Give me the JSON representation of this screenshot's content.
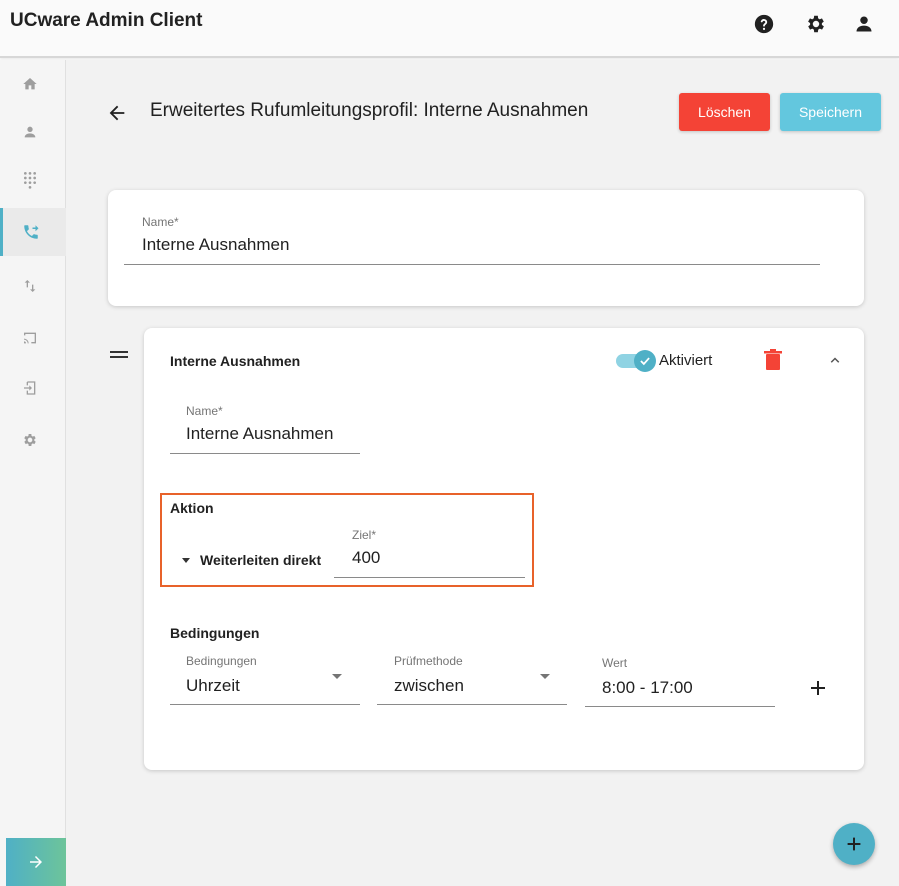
{
  "app": {
    "title": "UCware Admin Client"
  },
  "topbar": {
    "icons": [
      "help-icon",
      "settings-icon",
      "user-icon"
    ]
  },
  "sidebar": {
    "items": [
      {
        "icon": "home-icon"
      },
      {
        "icon": "person-icon"
      },
      {
        "icon": "dialpad-icon"
      },
      {
        "icon": "phone-forward-icon",
        "active": true
      },
      {
        "icon": "swap-vert-icon"
      },
      {
        "icon": "cast-icon"
      },
      {
        "icon": "device-login-icon"
      },
      {
        "icon": "gear-icon"
      }
    ]
  },
  "header": {
    "title": "Erweitertes Rufumleitungsprofil: Interne Ausnahmen",
    "delete_label": "Löschen",
    "save_label": "Speichern"
  },
  "profile": {
    "name_label": "Name*",
    "name_value": "Interne Ausnahmen"
  },
  "rule": {
    "title": "Interne Ausnahmen",
    "toggle_label": "Aktiviert",
    "toggle_on": true,
    "name_label": "Name*",
    "name_value": "Interne Ausnahmen",
    "action": {
      "heading": "Aktion",
      "type_value": "Weiterleiten direkt",
      "target_label": "Ziel*",
      "target_value": "400"
    },
    "conditions": {
      "heading": "Bedingungen",
      "condition_label": "Bedingungen",
      "condition_value": "Uhrzeit",
      "method_label": "Prüfmethode",
      "method_value": "zwischen",
      "value_label": "Wert",
      "value_value": "8:00 - 17:00"
    }
  },
  "colors": {
    "accent": "#4fb0c6",
    "danger": "#f44336",
    "highlight_border": "#e8622a"
  }
}
